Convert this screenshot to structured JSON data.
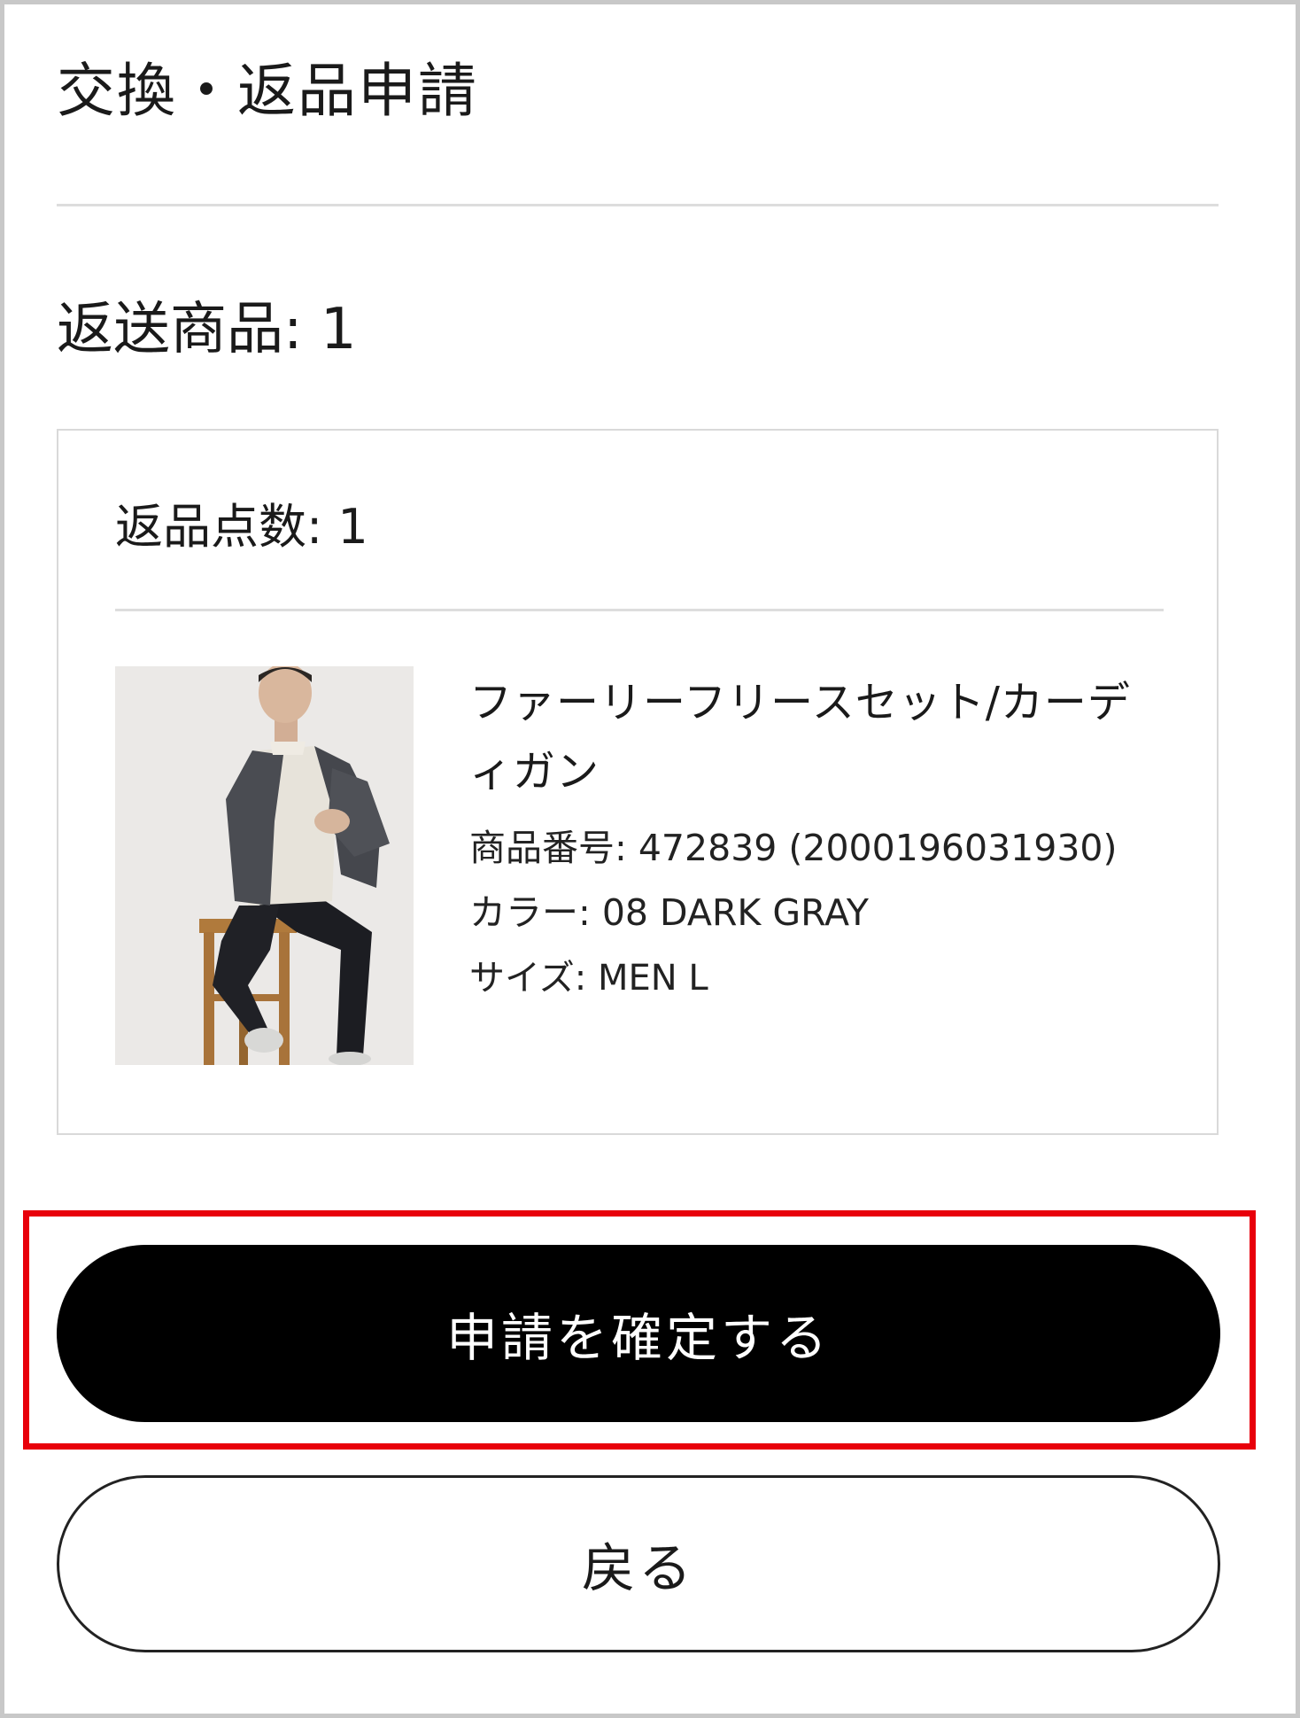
{
  "header": {
    "title": "交換・返品申請"
  },
  "return_section": {
    "heading": "返送商品: 1",
    "card": {
      "quantity_label": "返品点数: 1",
      "product": {
        "name": "ファーリーフリースセット/カーディガン",
        "code": "商品番号: 472839 (2000196031930)",
        "color": "カラー: 08 DARK GRAY",
        "size": "サイズ: MEN L",
        "image_icon": "product-photo"
      }
    }
  },
  "actions": {
    "confirm_label": "申請を確定する",
    "back_label": "戻る",
    "highlight_color": "#e8000b"
  },
  "colors": {
    "primary_button": "#000000",
    "divider": "#dddddd"
  }
}
